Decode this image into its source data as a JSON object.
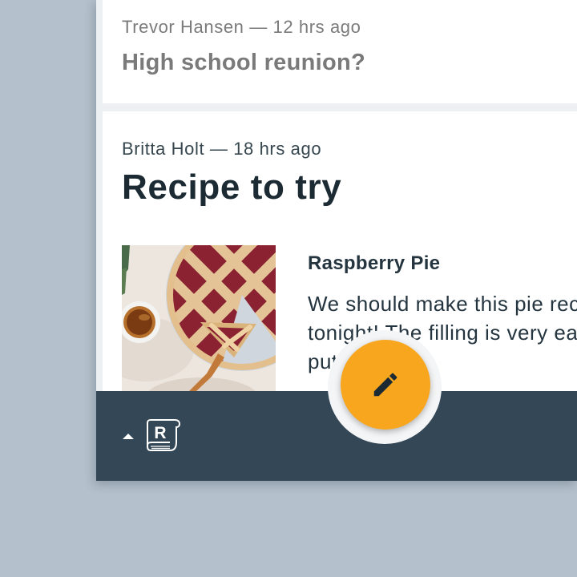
{
  "feed": {
    "posts": [
      {
        "author": "Trevor Hansen",
        "time_ago": "12 hrs ago",
        "meta": "Trevor Hansen — 12 hrs ago",
        "title": "High school reunion?"
      },
      {
        "author": "Britta Holt",
        "time_ago": "18 hrs ago",
        "meta": "Britta Holt — 18 hrs ago",
        "title": "Recipe to try",
        "attachment": {
          "name": "Raspberry Pie",
          "description": "We should make this pie recipe tonight! The filling is very easy to put together"
        }
      }
    ]
  },
  "bottom_bar": {
    "expand_icon": "caret-up-icon",
    "logo_icon": "reply-logo-icon",
    "logo_letter": "R"
  },
  "fab": {
    "icon": "pencil-icon"
  },
  "colors": {
    "backdrop": "#b4c0cc",
    "bottom_bar": "#344756",
    "fab": "#f9a61f",
    "title_dark": "#1c2a33",
    "text_muted": "#7a7a7a"
  }
}
